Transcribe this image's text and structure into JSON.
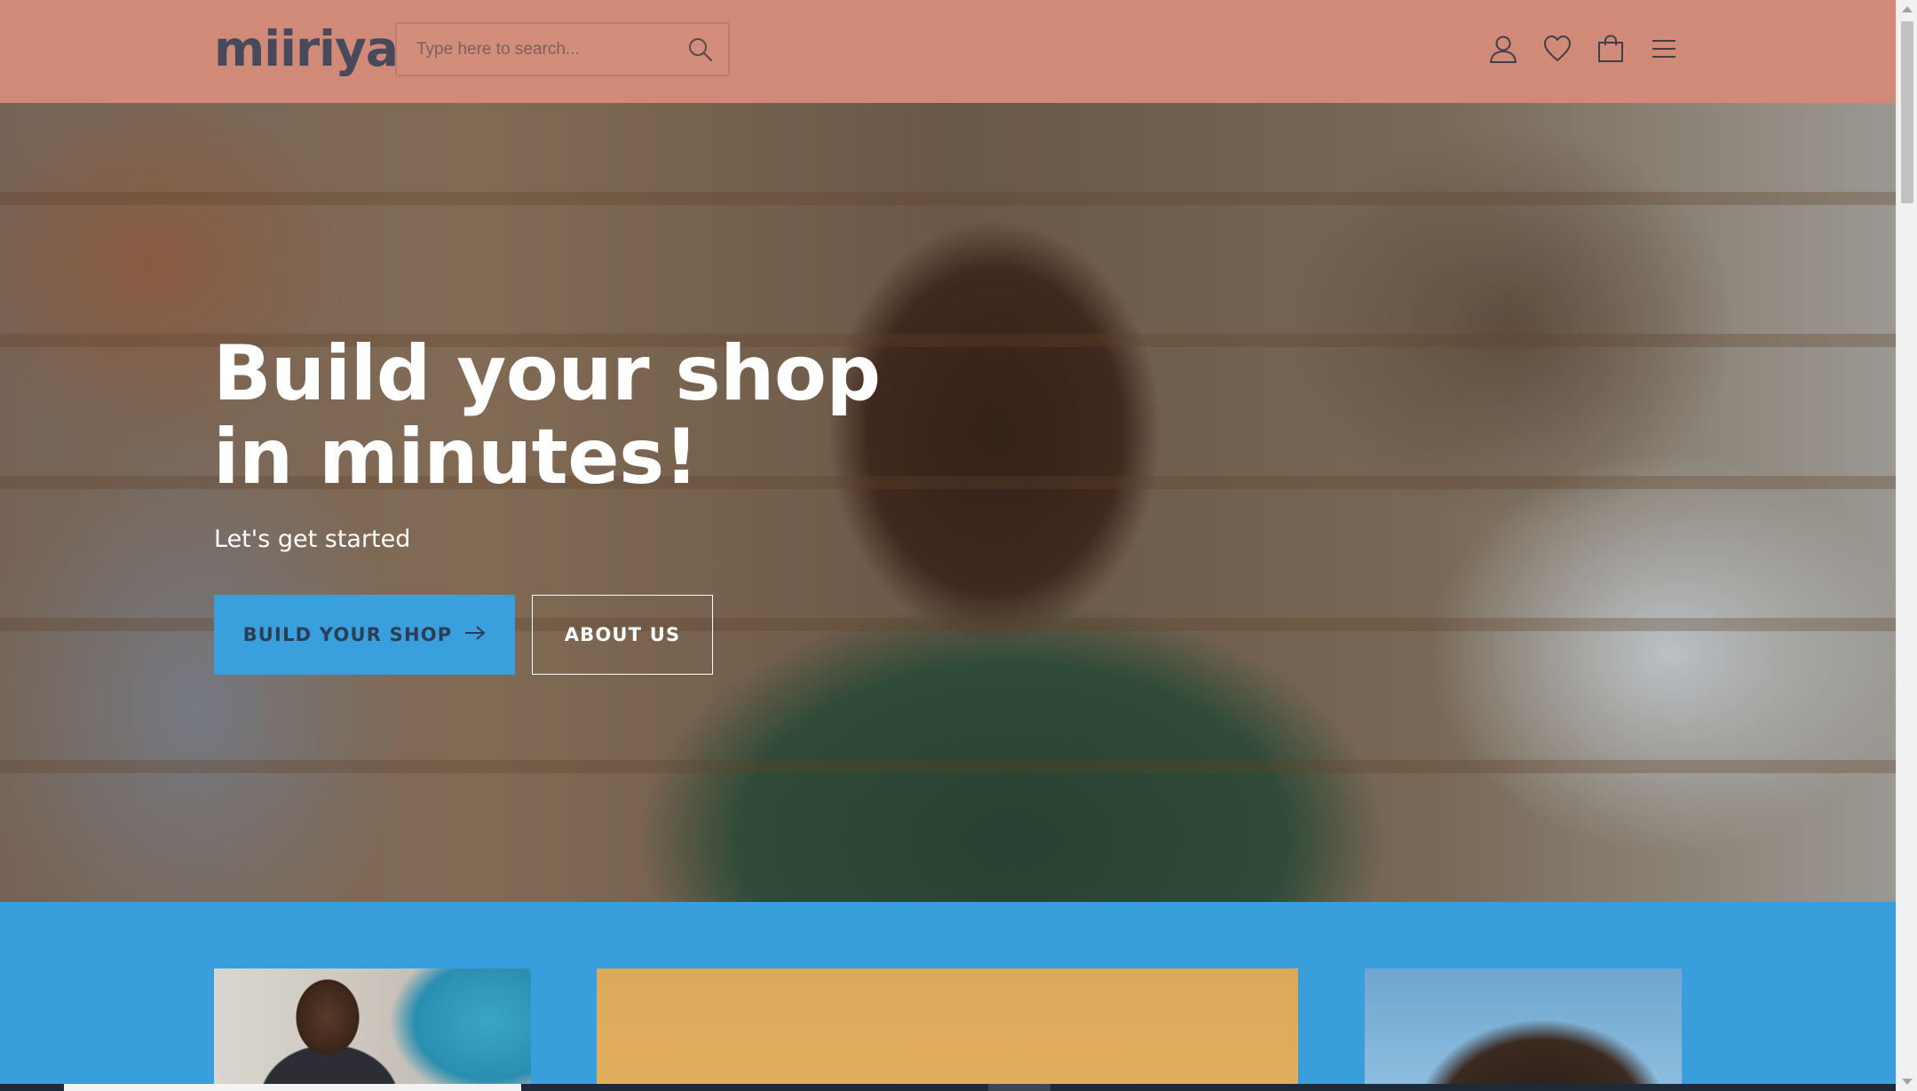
{
  "header": {
    "logo": "miiriya",
    "search": {
      "placeholder": "Type here to search..."
    },
    "icons": [
      "user-icon",
      "heart-icon",
      "shopping-bag-icon",
      "menu-icon"
    ]
  },
  "hero": {
    "title_line1": "Build your shop",
    "title_line2": "in minutes!",
    "subtitle": "Let's get started",
    "primary_button": "BUILD YOUR SHOP",
    "secondary_button": "ABOUT US"
  },
  "colors": {
    "header_bg": "#d18a78",
    "logo": "#474a5c",
    "primary_button": "#3aa0dd",
    "section_blue": "#389fdc"
  }
}
